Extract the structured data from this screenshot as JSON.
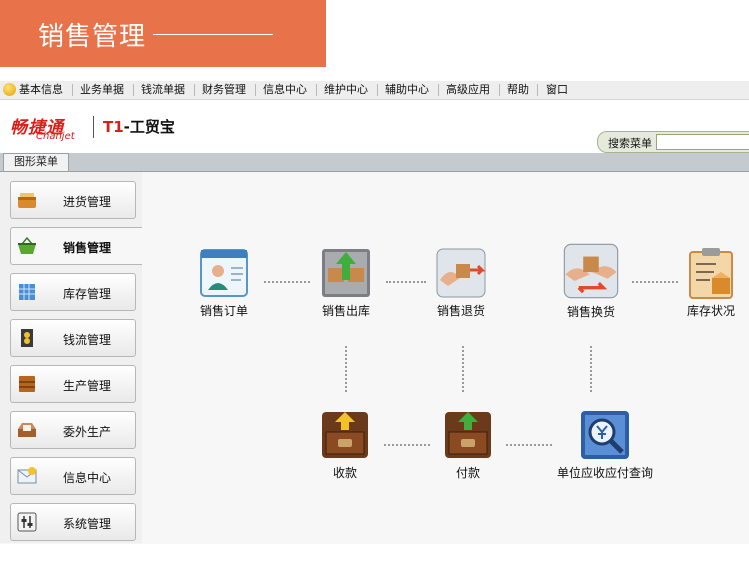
{
  "banner": {
    "title": "销售管理"
  },
  "menu": {
    "items": [
      "基本信息",
      "业务单据",
      "钱流单据",
      "财务管理",
      "信息中心",
      "维护中心",
      "辅助中心",
      "高级应用",
      "帮助",
      "窗口"
    ]
  },
  "logo": {
    "brand_cn": "畅捷通",
    "brand_en": "Chanjet",
    "product_prefix": "T1",
    "product_rest": "-工贸宝"
  },
  "search": {
    "label": "搜索菜单",
    "value": ""
  },
  "tabs": {
    "graphic_menu": "图形菜单"
  },
  "sidebar": {
    "items": [
      {
        "label": "进货管理"
      },
      {
        "label": "销售管理"
      },
      {
        "label": "库存管理"
      },
      {
        "label": "钱流管理"
      },
      {
        "label": "生产管理"
      },
      {
        "label": "委外生产"
      },
      {
        "label": "信息中心"
      },
      {
        "label": "系统管理"
      }
    ],
    "active_index": 1
  },
  "flow": {
    "nodes": [
      {
        "label": "销售订单",
        "icon": "order-form-icon"
      },
      {
        "label": "销售出库",
        "icon": "outbound-box-icon"
      },
      {
        "label": "销售退货",
        "icon": "return-goods-icon"
      },
      {
        "label": "销售换货",
        "icon": "exchange-goods-icon"
      },
      {
        "label": "库存状况",
        "icon": "inventory-clipboard-icon"
      },
      {
        "label": "收款",
        "icon": "receive-payment-icon"
      },
      {
        "label": "付款",
        "icon": "make-payment-icon"
      },
      {
        "label": "单位应收应付查询",
        "icon": "query-magnifier-icon"
      }
    ]
  },
  "colors": {
    "banner": "#e8724a",
    "brand_red": "#d8201b",
    "search_bg": "#e6eadb"
  }
}
